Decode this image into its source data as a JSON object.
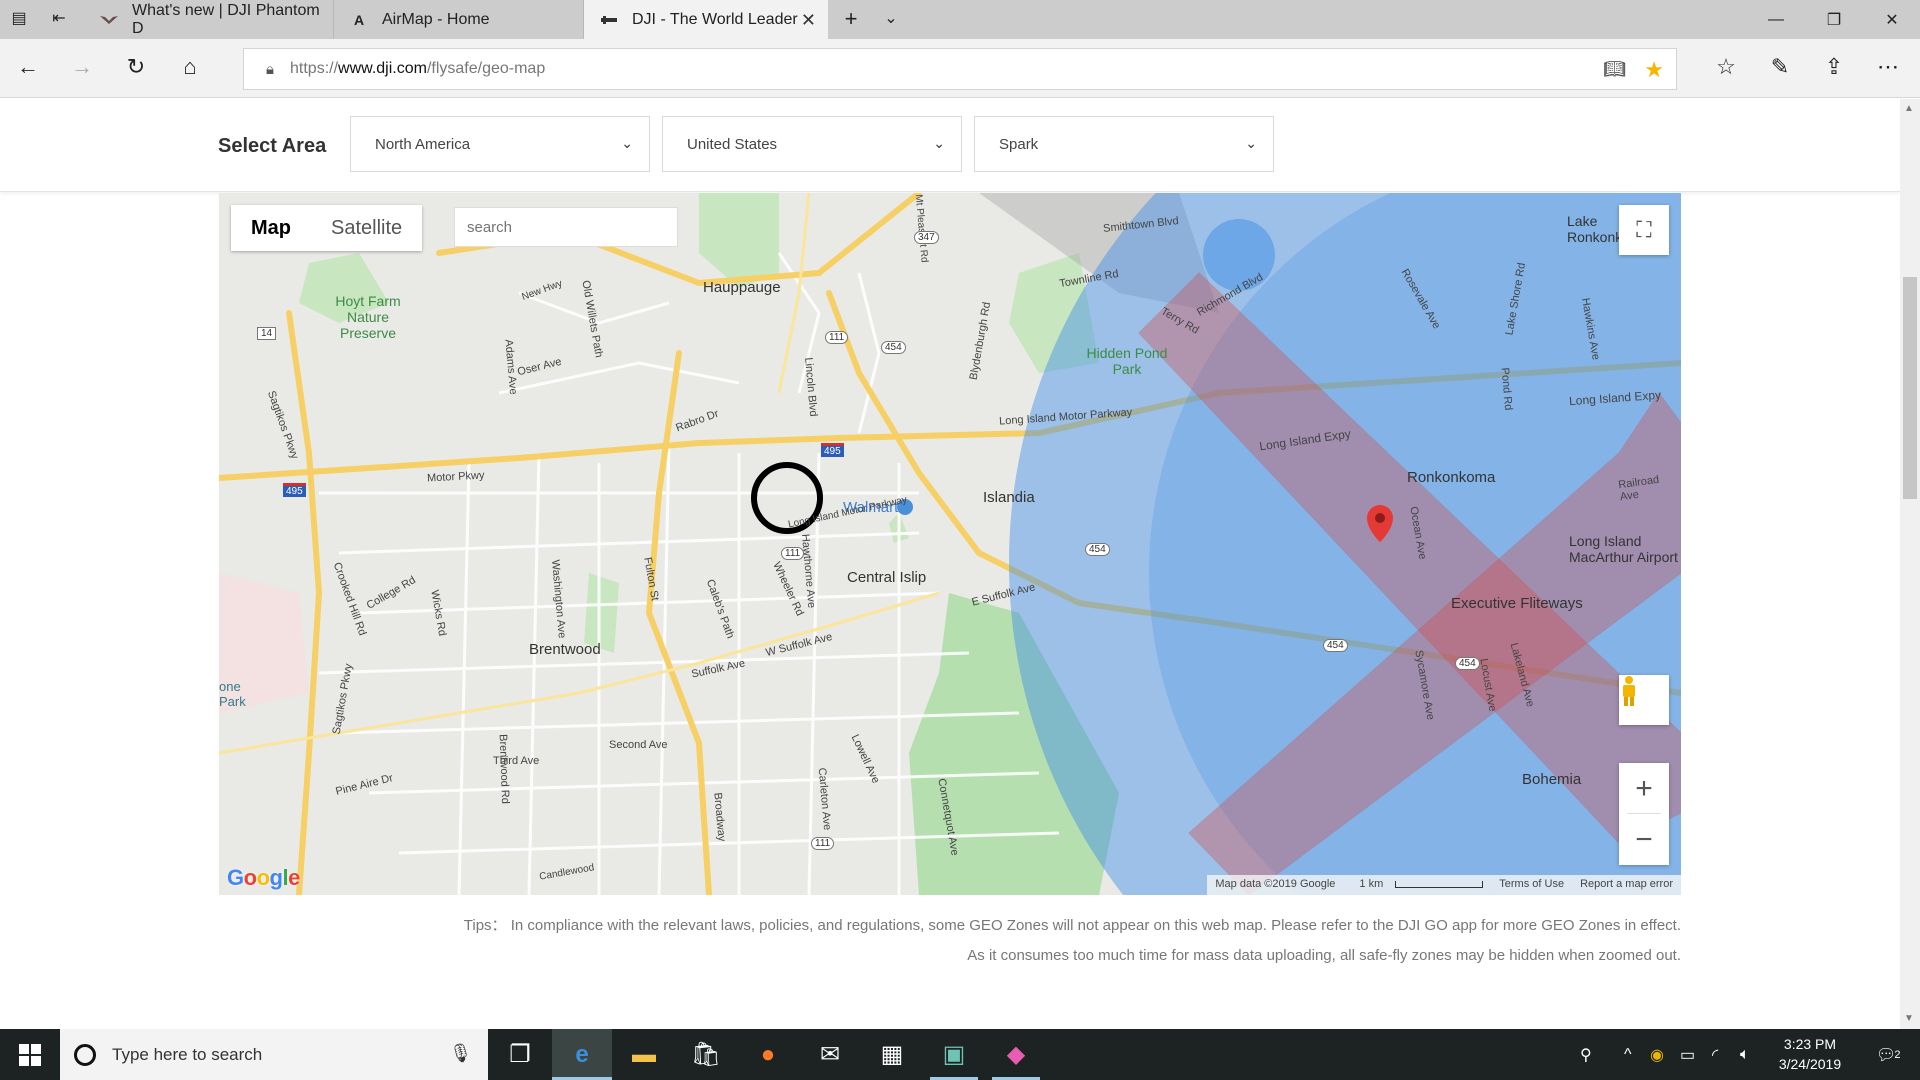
{
  "browser": {
    "tabs": [
      {
        "title": "What's new | DJI Phantom D",
        "favicon": "dji-wings-icon"
      },
      {
        "title": "AirMap - Home",
        "favicon": "airmap-a-icon"
      },
      {
        "title": "DJI - The World Leader",
        "favicon": "dji-logo-icon"
      }
    ],
    "url_prefix": "https://",
    "url_domain": "www.dji.com",
    "url_path": "/flysafe/geo-map",
    "accent_color": "#f7b500"
  },
  "select_area": {
    "label": "Select Area",
    "region": "North America",
    "country": "United States",
    "aircraft": "Spark"
  },
  "map": {
    "type_buttons": [
      "Map",
      "Satellite"
    ],
    "search_placeholder": "search",
    "footer": {
      "data": "Map data ©2019 Google",
      "scale": "1 km",
      "terms": "Terms of Use",
      "report": "Report a map error"
    },
    "google_logo": "Google",
    "zone_colors": {
      "authorization": "#3d8ee8",
      "restricted": "#d84848"
    },
    "places": [
      {
        "name": "Hauppauge"
      },
      {
        "name": "Hoyt Farm Nature Preserve"
      },
      {
        "name": "Hidden Pond Park"
      },
      {
        "name": "Islandia"
      },
      {
        "name": "Walmart"
      },
      {
        "name": "Central Islip"
      },
      {
        "name": "Brentwood"
      },
      {
        "name": "Ronkonkoma"
      },
      {
        "name": "Lake Ronkonkoma"
      },
      {
        "name": "Long Island MacArthur Airport"
      },
      {
        "name": "Executive Fliteways"
      },
      {
        "name": "Bohemia"
      },
      {
        "name": "one Park"
      }
    ],
    "roads": [
      "Long Island Expy",
      "Motor Pkwy",
      "Sagtikos Pkwy",
      "Suffolk Ave",
      "W Suffolk Ave",
      "E Suffolk Ave",
      "Long Island Motor Parkway",
      "Townline Rd",
      "Rabro Dr",
      "Oser Ave",
      "Crooked Hill Rd",
      "College Rd",
      "Wicks Rd",
      "Washington Ave",
      "Fulton St",
      "Caleb's Path",
      "Wheeler Rd",
      "Hawthorne Ave",
      "Carleton Ave",
      "Lowell Ave",
      "Connetquot Ave",
      "Second Ave",
      "Third Ave",
      "Pine Aire Dr",
      "Broadway",
      "Brentwood Rd",
      "Adams Ave",
      "Old Willets Path",
      "Lincoln Blvd",
      "Blydenburgh Rd",
      "Terry Rd",
      "Smithtown Blvd",
      "Richmond Blvd",
      "Ocean Ave",
      "Sycamore Ave",
      "Locust Ave",
      "Lakeland Ave",
      "Railroad Ave",
      "Hawkins Ave",
      "Lake Shore Rd",
      "Pond Rd",
      "Rosevale Ave",
      "New Hwy",
      "Mt Pleasant Rd",
      "Candlewood"
    ],
    "route_shields": [
      "347",
      "111",
      "454",
      "495",
      "14"
    ]
  },
  "tips": {
    "line1": "Tips：  In compliance with the relevant laws, policies, and regulations, some GEO Zones will not appear on this web map. Please refer to the DJI GO app for more GEO Zones in effect.",
    "line2": "As it consumes too much time for mass data uploading, all safe-fly zones may be hidden when zoomed out."
  },
  "taskbar": {
    "search_placeholder": "Type here to search",
    "time": "3:23 PM",
    "date": "3/24/2019",
    "notification_count": "2"
  }
}
